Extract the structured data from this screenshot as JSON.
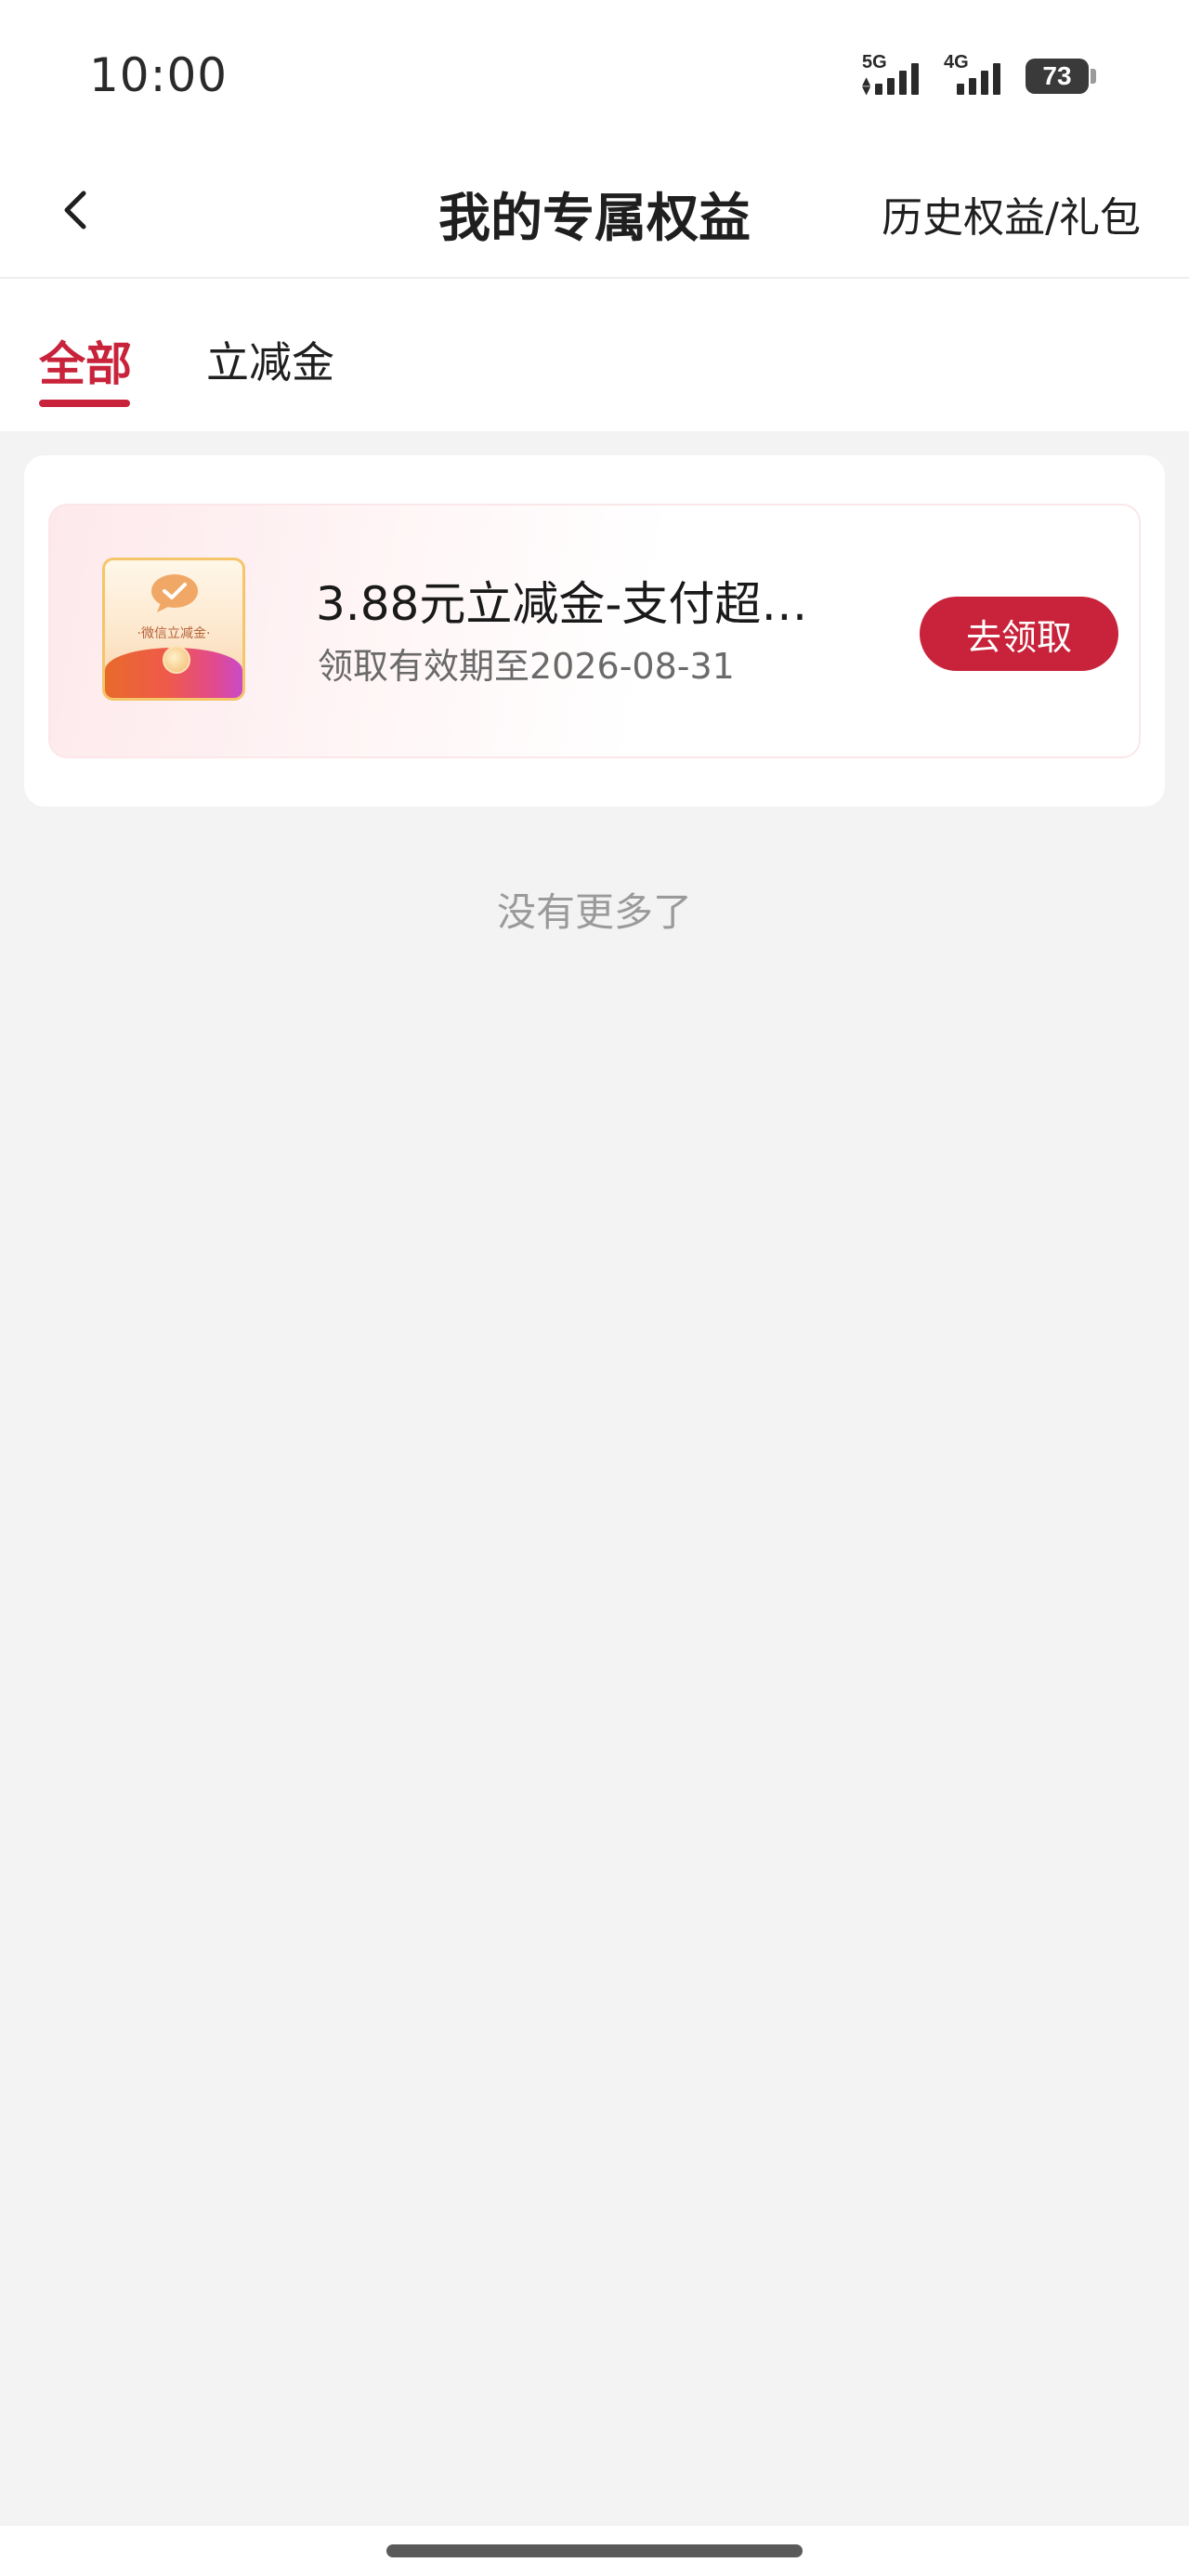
{
  "status_bar": {
    "time": "10:00",
    "network_1": "5G",
    "network_2": "4G",
    "battery": "73"
  },
  "nav": {
    "title": "我的专属权益",
    "right_link": "历史权益/礼包"
  },
  "tabs": [
    {
      "label": "全部",
      "active": true
    },
    {
      "label": "立减金",
      "active": false
    }
  ],
  "coupons": [
    {
      "icon_text": "·微信立减金·",
      "title": "3.88元立减金-支付超…",
      "subtitle": "领取有效期至2026-08-31",
      "button_label": "去领取"
    }
  ],
  "footer_text": "没有更多了",
  "colors": {
    "accent": "#c8233a",
    "background": "#f3f3f3"
  }
}
